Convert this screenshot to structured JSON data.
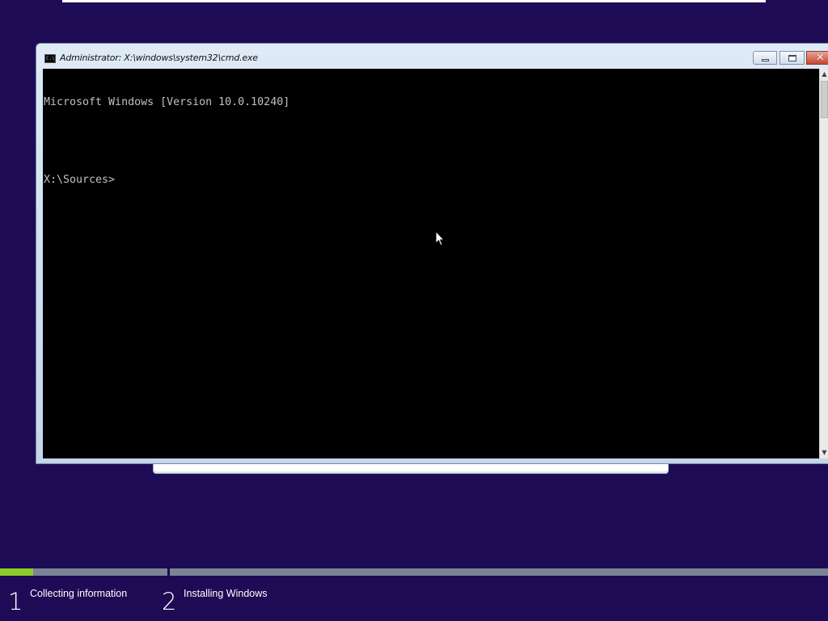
{
  "window": {
    "title": "Administrator: X:\\windows\\system32\\cmd.exe",
    "icon": "cmd-icon",
    "icon_text": "C:\\",
    "controls": [
      "minimize-icon",
      "maximize-icon",
      "close-icon"
    ],
    "close_glyph": "✕"
  },
  "console": {
    "lines": [
      "Microsoft Windows [Version 10.0.10240]",
      "",
      "X:\\Sources>"
    ],
    "background": "#000000",
    "foreground": "#c0c0c0"
  },
  "scrollbar": {
    "up_glyph": "▲",
    "down_glyph": "▼"
  },
  "setup": {
    "background": "#1e0b55",
    "progress": {
      "step1_fraction": 0.2,
      "step2_fraction": 0,
      "fill_color": "#8fcc28"
    },
    "steps": [
      {
        "number": "1",
        "label": "Collecting information"
      },
      {
        "number": "2",
        "label": "Installing Windows"
      }
    ]
  }
}
